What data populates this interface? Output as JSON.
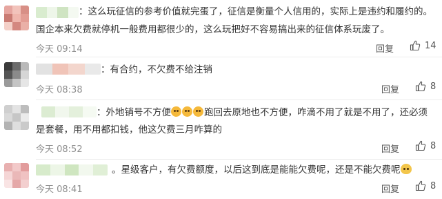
{
  "comments": [
    {
      "text_lines": [
        "：这么玩征信的参考价值就完蛋了，征信是衡量个人信用的，实际上是违约和履约的。",
        "国企本来欠费就停机一般费用都很少的，这么玩把好不容易搞出来的征信体系玩废了。"
      ],
      "time": "今天 09:14",
      "reply_label": "回复",
      "likes": "14"
    },
    {
      "text_lines": [
        "：有合约，不欠费不给注销"
      ],
      "time": "今天 08:38",
      "reply_label": "回复",
      "likes": "8"
    },
    {
      "text_line1_a": "：外地销号不方便",
      "text_line1_b": "跑回去原地也不方便，咋滴不用了就是不用了，还必须",
      "text_line2": "是套餐，用不用都扣钱，他这欠费三月咋算的",
      "time": "今天 08:52",
      "reply_label": "回复",
      "likes": "8"
    },
    {
      "text_main": "。星级客户，有欠费额度，以后这到底是能能欠费呢，还是不能欠费呢",
      "time": "今天 08:41",
      "reply_label": "回复",
      "likes": "8"
    }
  ]
}
